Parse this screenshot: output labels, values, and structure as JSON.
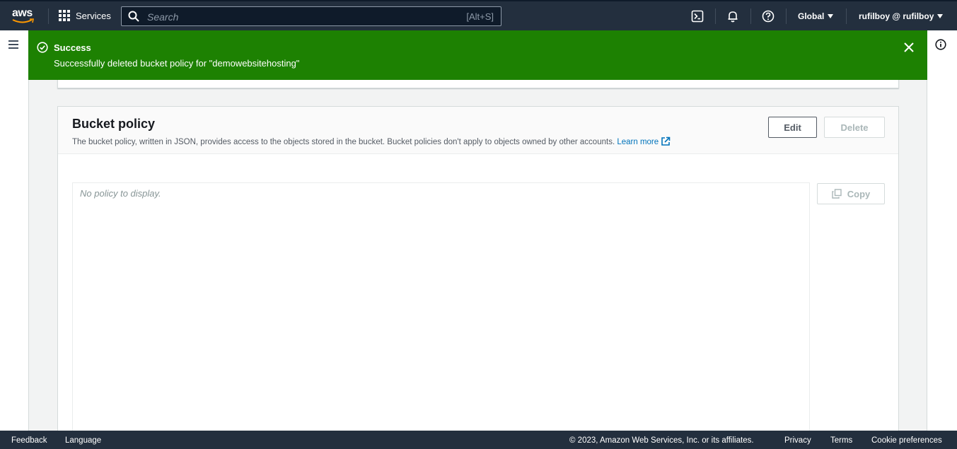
{
  "topnav": {
    "logo_text": "aws",
    "services_label": "Services",
    "search_placeholder": "Search",
    "search_shortcut": "[Alt+S]",
    "region_label": "Global",
    "account_label": "rufilboy @ rufilboy"
  },
  "flash": {
    "title": "Success",
    "message": "Successfully deleted bucket policy for \"demowebsitehosting\"",
    "color": "#1d8102"
  },
  "bucket_policy": {
    "title": "Bucket policy",
    "description": "The bucket policy, written in JSON, provides access to the objects stored in the bucket. Bucket policies don't apply to objects owned by other accounts.",
    "learn_more": "Learn more",
    "edit_label": "Edit",
    "delete_label": "Delete",
    "empty_text": "No policy to display.",
    "copy_label": "Copy"
  },
  "footer": {
    "feedback": "Feedback",
    "language": "Language",
    "copyright": "© 2023, Amazon Web Services, Inc. or its affiliates.",
    "privacy": "Privacy",
    "terms": "Terms",
    "cookies": "Cookie preferences"
  },
  "colors": {
    "nav_bg": "#232f3e",
    "link": "#0073bb",
    "success": "#1d8102"
  },
  "icons": [
    "grid-icon",
    "search-icon",
    "cloudshell-icon",
    "bell-icon",
    "help-icon",
    "menu-icon",
    "info-icon",
    "success-check-icon",
    "close-icon",
    "external-link-icon",
    "copy-icon"
  ]
}
